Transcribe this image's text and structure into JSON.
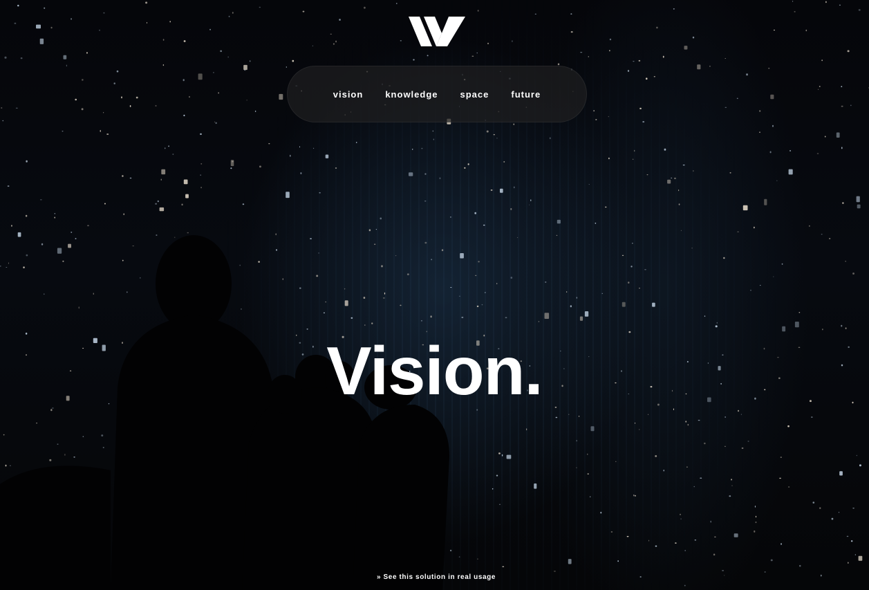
{
  "header": {
    "logo_icon": "wy-monogram-logo"
  },
  "nav": {
    "items": [
      {
        "label": "vision"
      },
      {
        "label": "knowledge"
      },
      {
        "label": "space"
      },
      {
        "label": "future"
      }
    ]
  },
  "hero": {
    "title": "Vision."
  },
  "footer": {
    "link_prefix": "»",
    "link_text": "See this solution in real usage"
  },
  "colors": {
    "text": "#ffffff",
    "nav_background": "#1e1e20",
    "page_background": "#030305"
  }
}
